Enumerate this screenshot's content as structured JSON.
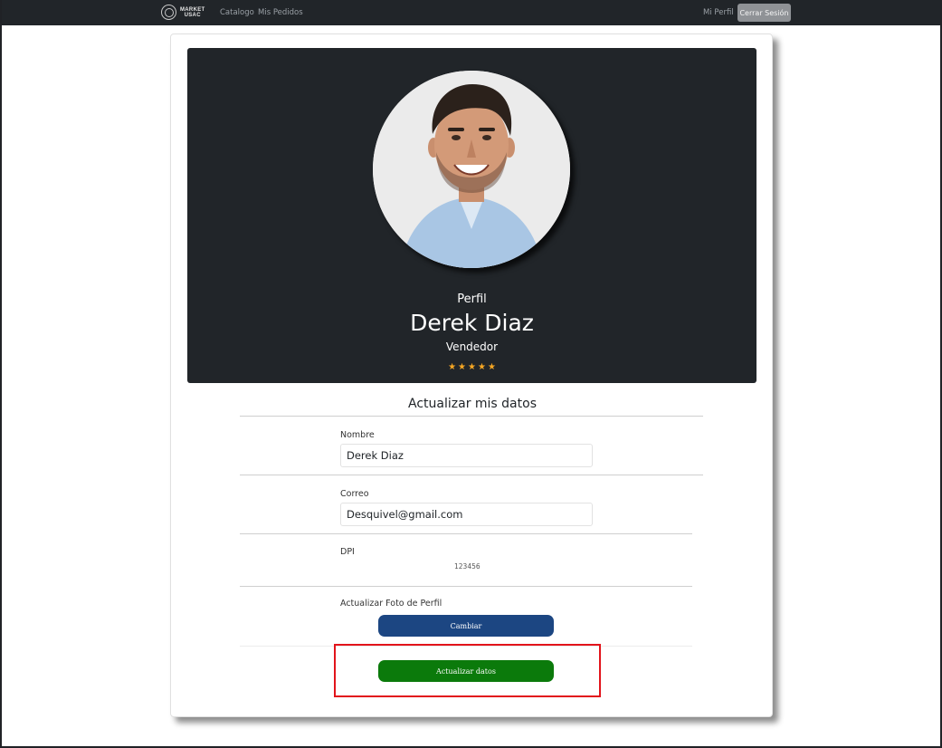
{
  "navbar": {
    "brand_line1": "MARKET",
    "brand_line2": "USAC",
    "links": [
      "Catalogo",
      "Mis Pedidos"
    ],
    "profile_link": "Mi Perfil",
    "logout_label": "Cerrar Sesión"
  },
  "profile": {
    "heading": "Perfil",
    "name": "Derek Diaz",
    "role": "Vendedor",
    "stars": "★★★★★"
  },
  "form": {
    "title": "Actualizar mis datos",
    "name_label": "Nombre",
    "name_value": "Derek Diaz",
    "email_label": "Correo",
    "email_value": "Desquivel@gmail.com",
    "dpi_label": "DPI",
    "dpi_value": "123456",
    "photo_label": "Actualizar Foto de Perfil",
    "change_button": "Cambiar",
    "update_button": "Actualizar datos"
  },
  "colors": {
    "navbar_bg": "#212529",
    "hero_bg": "#212529",
    "change_button": "#1c4682",
    "update_button": "#0b7a0b",
    "star": "#f5a623",
    "highlight": "#e2141b"
  }
}
